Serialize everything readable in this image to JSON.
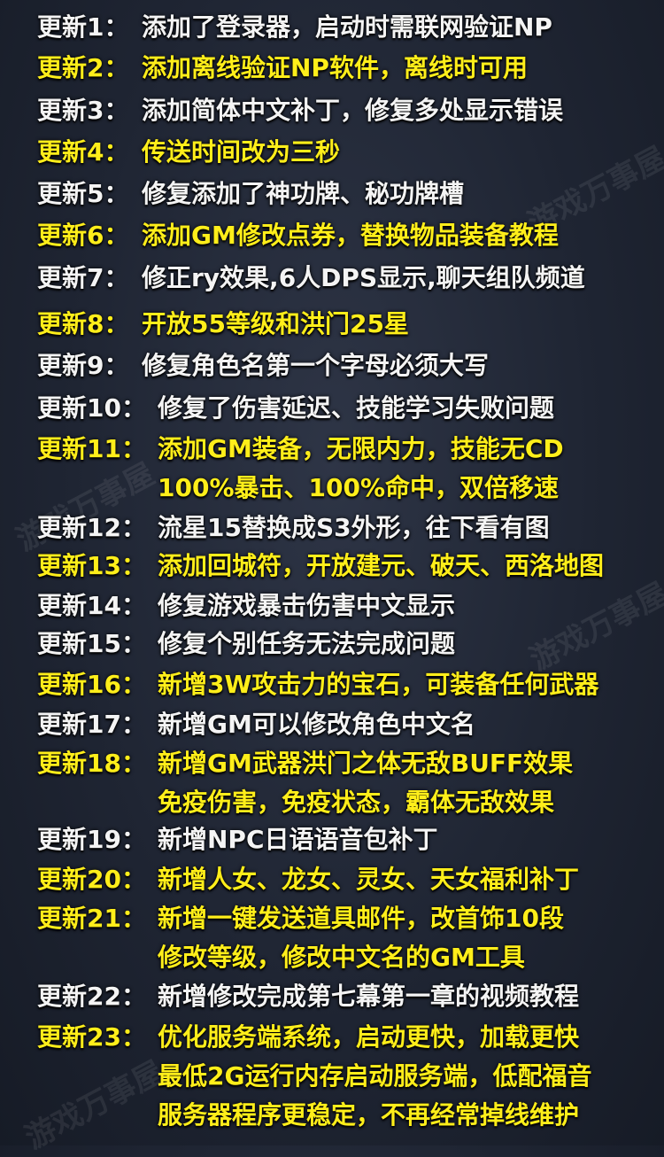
{
  "watermark": "游戏万事屋",
  "updates": [
    {
      "label": "更新1：",
      "lines": [
        "添加了登录器，启动时需联网验证NP"
      ],
      "color": "white"
    },
    {
      "label": "更新2：",
      "lines": [
        "添加离线验证NP软件，离线时可用"
      ],
      "color": "yellow"
    },
    {
      "label": "更新3：",
      "lines": [
        "添加简体中文补丁，修复多处显示错误"
      ],
      "color": "white"
    },
    {
      "label": "更新4：",
      "lines": [
        "传送时间改为三秒"
      ],
      "color": "yellow"
    },
    {
      "label": "更新5：",
      "lines": [
        "修复添加了神功牌、秘功牌槽"
      ],
      "color": "white"
    },
    {
      "label": "更新6：",
      "lines": [
        "添加GM修改点券，替换物品装备教程"
      ],
      "color": "yellow"
    },
    {
      "label": "更新7：",
      "lines": [
        "修正ry效果,6人DPS显示,聊天组队频道"
      ],
      "color": "white"
    },
    {
      "label": "更新8：",
      "lines": [
        "开放55等级和洪门25星"
      ],
      "color": "yellow"
    },
    {
      "label": "更新9：",
      "lines": [
        "修复角色名第一个字母必须大写"
      ],
      "color": "white"
    },
    {
      "label": "更新10：",
      "lines": [
        "修复了伤害延迟、技能学习失败问题"
      ],
      "color": "white"
    },
    {
      "label": "更新11：",
      "lines": [
        "添加GM装备，无限内力，技能无CD",
        "100%暴击、100%命中，双倍移速"
      ],
      "color": "yellow"
    },
    {
      "label": "更新12：",
      "lines": [
        "流星15替换成S3外形，往下看有图"
      ],
      "color": "white"
    },
    {
      "label": "更新13：",
      "lines": [
        "添加回城符，开放建元、破天、西洛地图"
      ],
      "color": "yellow"
    },
    {
      "label": "更新14：",
      "lines": [
        "修复游戏暴击伤害中文显示"
      ],
      "color": "white"
    },
    {
      "label": "更新15：",
      "lines": [
        "修复个别任务无法完成问题"
      ],
      "color": "white"
    },
    {
      "label": "更新16：",
      "lines": [
        "新增3W攻击力的宝石，可装备任何武器"
      ],
      "color": "yellow"
    },
    {
      "label": "更新17：",
      "lines": [
        "新增GM可以修改角色中文名"
      ],
      "color": "white"
    },
    {
      "label": "更新18：",
      "lines": [
        "新增GM武器洪门之体无敌BUFF效果",
        "免疫伤害，免疫状态，霸体无敌效果"
      ],
      "color": "yellow"
    },
    {
      "label": "更新19：",
      "lines": [
        "新增NPC日语语音包补丁"
      ],
      "color": "white"
    },
    {
      "label": "更新20：",
      "lines": [
        "新增人女、龙女、灵女、天女福利补丁"
      ],
      "color": "yellow"
    },
    {
      "label": "更新21：",
      "lines": [
        "新增一键发送道具邮件，改首饰10段",
        "修改等级，修改中文名的GM工具"
      ],
      "color": "yellow"
    },
    {
      "label": "更新22：",
      "lines": [
        "新增修改完成第七幕第一章的视频教程"
      ],
      "color": "white"
    },
    {
      "label": "更新23：",
      "lines": [
        "优化服务端系统，启动更快，加载更快",
        "最低2G运行内存启动服务端，低配福音",
        "服务器程序更稳定，不再经常掉线维护"
      ],
      "color": "yellow"
    }
  ]
}
